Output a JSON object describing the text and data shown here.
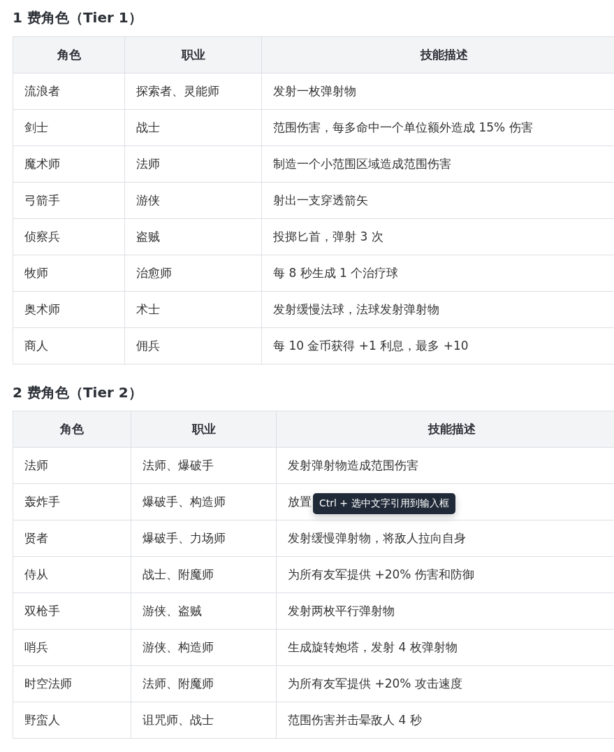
{
  "sections": [
    {
      "heading": "1 费角色（Tier 1）",
      "columns": [
        "角色",
        "职业",
        "技能描述"
      ],
      "rows": [
        [
          "流浪者",
          "探索者、灵能师",
          "发射一枚弹射物"
        ],
        [
          "剑士",
          "战士",
          "范围伤害，每多命中一个单位额外造成 15% 伤害"
        ],
        [
          "魔术师",
          "法师",
          "制造一个小范围区域造成范围伤害"
        ],
        [
          "弓箭手",
          "游侠",
          "射出一支穿透箭矢"
        ],
        [
          "侦察兵",
          "盗贼",
          "投掷匕首，弹射 3 次"
        ],
        [
          "牧师",
          "治愈师",
          "每 8 秒生成 1 个治疗球"
        ],
        [
          "奥术师",
          "术士",
          "发射缓慢法球，法球发射弹射物"
        ],
        [
          "商人",
          "佣兵",
          "每 10 金币获得 +1 利息，最多 +10"
        ]
      ]
    },
    {
      "heading": "2 费角色（Tier 2）",
      "columns": [
        "角色",
        "职业",
        "技能描述"
      ],
      "rows": [
        [
          "法师",
          "法师、爆破手",
          "发射弹射物造成范围伤害"
        ],
        [
          "轰炸手",
          "爆破手、构造师",
          "放置"
        ],
        [
          "贤者",
          "爆破手、力场师",
          "发射缓慢弹射物，将敌人拉向自身"
        ],
        [
          "侍从",
          "战士、附魔师",
          "为所有友军提供 +20% 伤害和防御"
        ],
        [
          "双枪手",
          "游侠、盗贼",
          "发射两枚平行弹射物"
        ],
        [
          "哨兵",
          "游侠、构造师",
          "生成旋转炮塔，发射 4 枚弹射物"
        ],
        [
          "时空法师",
          "法师、附魔师",
          "为所有友军提供 +20% 攻击速度"
        ],
        [
          "野蛮人",
          "诅咒师、战士",
          "范围伤害并击晕敌人 4 秒"
        ]
      ]
    }
  ],
  "tooltip": {
    "text": "Ctrl + 选中文字引用到输入框"
  }
}
